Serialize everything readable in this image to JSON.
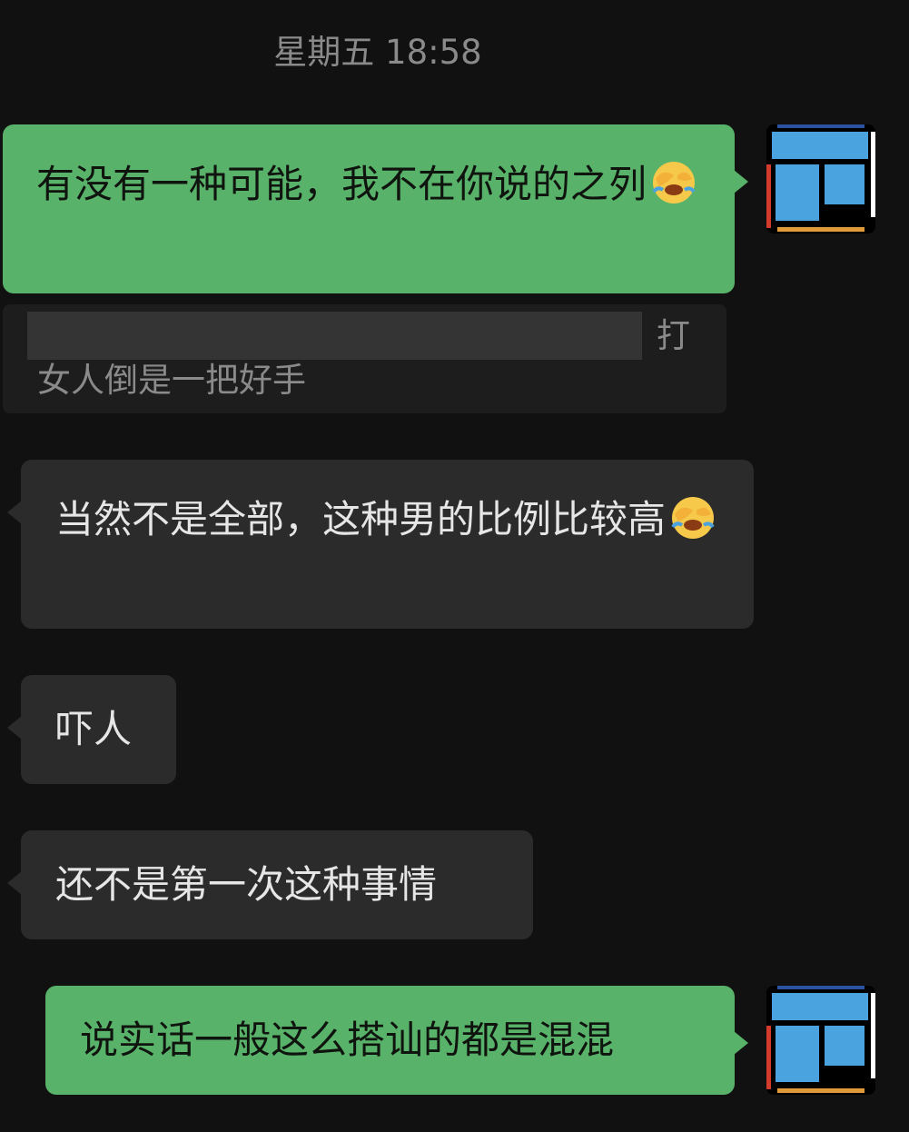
{
  "chat": {
    "timestamp": "星期五 18:58",
    "messages": [
      {
        "side": "right",
        "text": "有没有一种可能，我不在你说的之列",
        "emoji": "face-palm-crying-emoji"
      },
      {
        "side": "quote",
        "redacted": true,
        "tail_text": "打",
        "text": "女人倒是一把好手"
      },
      {
        "side": "left",
        "text": "当然不是全部，这种男的比例比较高",
        "emoji": "face-palm-crying-emoji"
      },
      {
        "side": "left",
        "text": "吓人"
      },
      {
        "side": "left",
        "text": "还不是第一次这种事情"
      },
      {
        "side": "right",
        "text": "说实话一般这么搭讪的都是混混"
      }
    ]
  },
  "colors": {
    "background": "#111111",
    "outgoing_bubble": "#59b26a",
    "incoming_bubble": "#2b2b2b",
    "quote_bg": "#1d1d1d",
    "muted_text": "#8a8a8a",
    "avatar_blue": "#4aa3df",
    "avatar_red": "#d33b2a",
    "avatar_orange": "#e09a3a"
  },
  "icons": {
    "avatar": "mondrian-blocks-avatar-icon",
    "emoji": "face-palm-crying-emoji"
  }
}
